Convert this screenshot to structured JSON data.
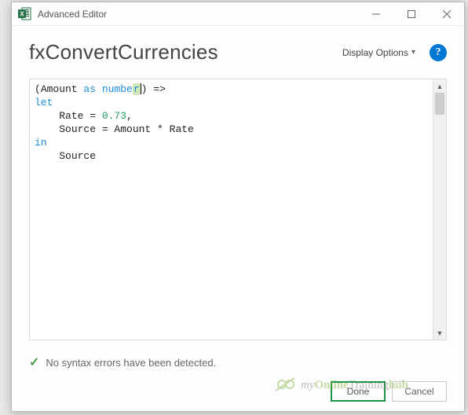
{
  "window": {
    "title": "Advanced Editor"
  },
  "header": {
    "query_name": "fxConvertCurrencies",
    "display_options_label": "Display Options",
    "help_char": "?"
  },
  "code": {
    "tokens": {
      "paren_open": "(",
      "param": "Amount ",
      "kw_as": "as",
      "sp": " ",
      "type_number_part": "numbe",
      "type_number_last": "r",
      "paren_close_arrow": ") =>",
      "kw_let": "let",
      "indent": "    ",
      "rate_assign": "Rate = ",
      "rate_val": "0.73",
      "comma": ",",
      "source_line": "Source = Amount * Rate",
      "kw_in": "in",
      "source_ref": "Source"
    }
  },
  "status": {
    "text": "No syntax errors have been detected."
  },
  "buttons": {
    "done": "Done",
    "cancel": "Cancel"
  },
  "watermark": {
    "brand_my": "my",
    "brand_online": "Online",
    "brand_training": "Training",
    "brand_hub": "hub"
  }
}
